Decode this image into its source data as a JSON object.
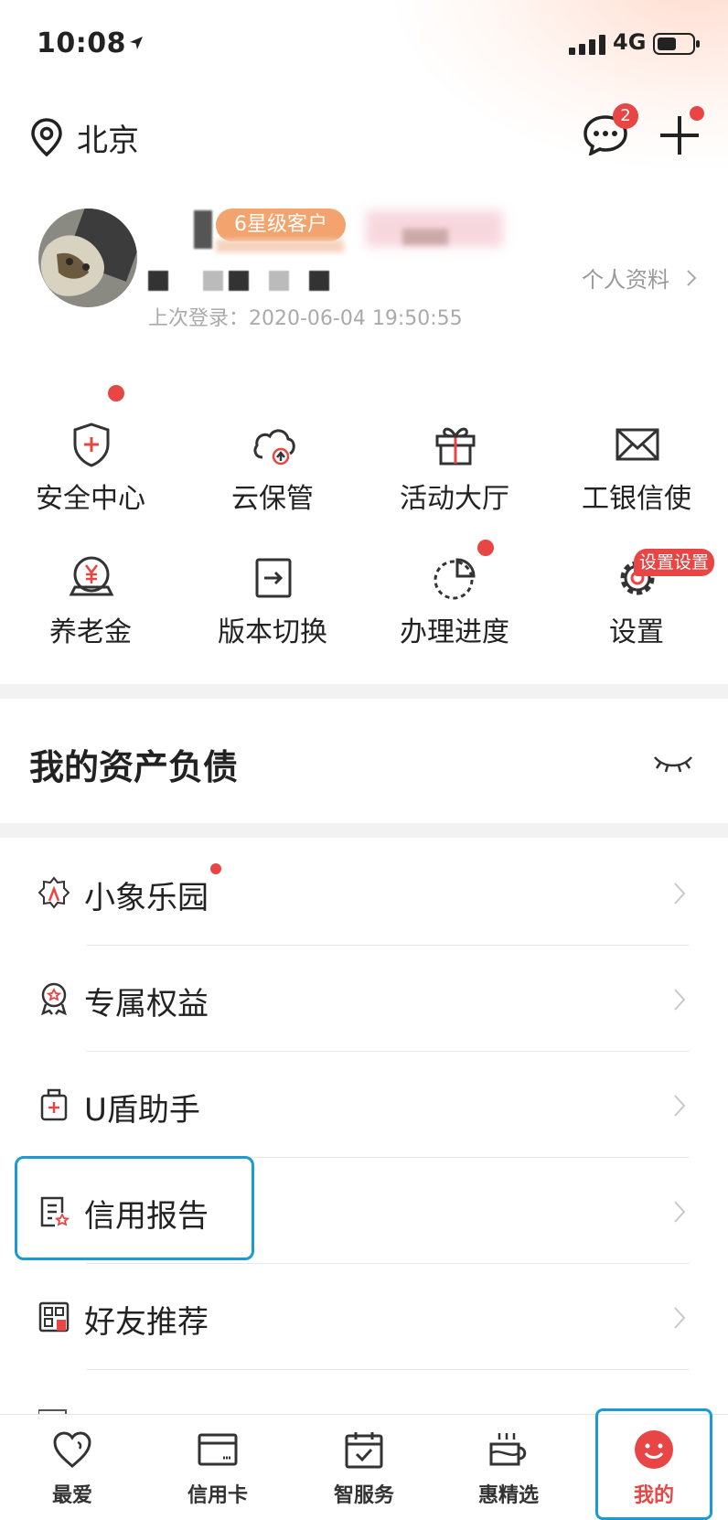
{
  "status_bar": {
    "time": "10:08",
    "network": "4G"
  },
  "header": {
    "city": "北京",
    "message_badge": "2"
  },
  "profile": {
    "level_badge": "6星级客户",
    "profile_link": "个人资料",
    "last_login": "上次登录：2020-06-04 19:50:55"
  },
  "shortcuts": [
    {
      "label": "安全中心",
      "icon": "shield-plus-icon"
    },
    {
      "label": "云保管",
      "icon": "cloud-upload-icon"
    },
    {
      "label": "活动大厅",
      "icon": "gift-icon"
    },
    {
      "label": "工银信使",
      "icon": "envelope-icon"
    },
    {
      "label": "养老金",
      "icon": "yen-coin-icon"
    },
    {
      "label": "版本切换",
      "icon": "switch-arrow-icon"
    },
    {
      "label": "办理进度",
      "icon": "progress-pie-icon"
    },
    {
      "label": "设置",
      "icon": "gear-icon"
    }
  ],
  "settings_tag": "设置设置",
  "assets": {
    "title": "我的资产负债"
  },
  "menu": [
    {
      "label": "小象乐园",
      "icon": "elephant-icon"
    },
    {
      "label": "专属权益",
      "icon": "ribbon-award-icon"
    },
    {
      "label": "U盾助手",
      "icon": "ukey-icon"
    },
    {
      "label": "信用报告",
      "icon": "credit-report-icon"
    },
    {
      "label": "好友推荐",
      "icon": "qr-share-icon"
    }
  ],
  "tabs": [
    {
      "label": "最爱",
      "icon": "heart-icon"
    },
    {
      "label": "信用卡",
      "icon": "credit-card-icon"
    },
    {
      "label": "智服务",
      "icon": "calendar-check-icon"
    },
    {
      "label": "惠精选",
      "icon": "cup-icon"
    },
    {
      "label": "我的",
      "icon": "smiley-icon",
      "active": true
    }
  ],
  "colors": {
    "accent_red": "#e84545",
    "highlight_blue": "#1a9ad6",
    "badge_orange": "#f2a36e"
  }
}
